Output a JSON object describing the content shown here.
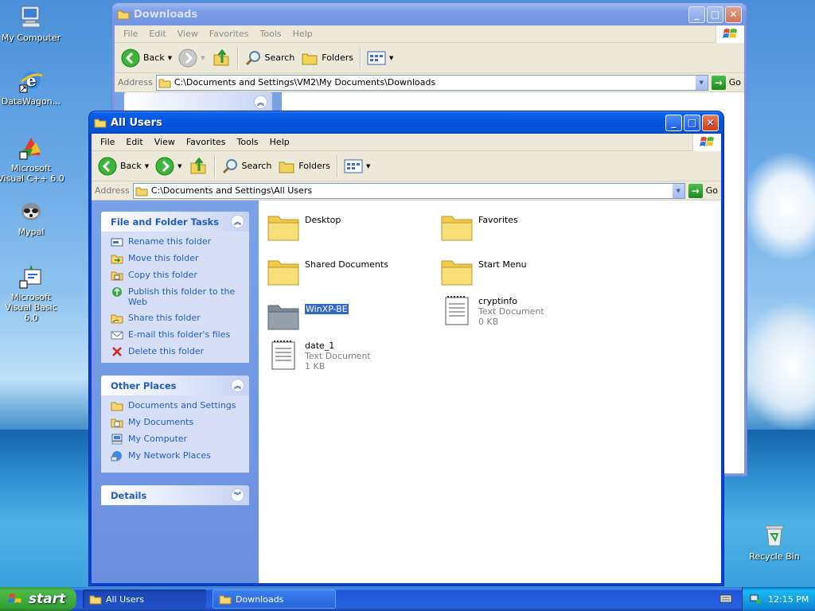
{
  "desktop": {
    "icons": [
      {
        "label": "My Computer",
        "icon": "my-computer-icon"
      },
      {
        "label": "DataWagon...",
        "icon": "internet-explorer-shortcut-icon"
      },
      {
        "label": "Microsoft Visual C++ 6.0",
        "icon": "visual-cpp-icon"
      },
      {
        "label": "Mypal",
        "icon": "mypal-icon"
      },
      {
        "label": "Microsoft Visual Basic 6.0",
        "icon": "visual-basic-icon"
      },
      {
        "label": "Recycle Bin",
        "icon": "recycle-bin-icon"
      }
    ]
  },
  "downloads_window": {
    "title": "Downloads",
    "menu": [
      "File",
      "Edit",
      "View",
      "Favorites",
      "Tools",
      "Help"
    ],
    "toolbar": {
      "back": "Back",
      "search": "Search",
      "folders": "Folders"
    },
    "address_label": "Address",
    "address": "C:\\Documents and Settings\\VM2\\My Documents\\Downloads",
    "go": "Go"
  },
  "allusers_window": {
    "title": "All Users",
    "menu": [
      "File",
      "Edit",
      "View",
      "Favorites",
      "Tools",
      "Help"
    ],
    "toolbar": {
      "back": "Back",
      "search": "Search",
      "folders": "Folders"
    },
    "address_label": "Address",
    "address": "C:\\Documents and Settings\\All Users",
    "go": "Go",
    "file_tasks": {
      "title": "File and Folder Tasks",
      "items": [
        "Rename this folder",
        "Move this folder",
        "Copy this folder",
        "Publish this folder to the Web",
        "Share this folder",
        "E-mail this folder's files",
        "Delete this folder"
      ]
    },
    "other_places": {
      "title": "Other Places",
      "items": [
        "Documents and Settings",
        "My Documents",
        "My Computer",
        "My Network Places"
      ]
    },
    "details": {
      "title": "Details"
    },
    "files": [
      {
        "name": "Desktop",
        "type": "",
        "size": ""
      },
      {
        "name": "Favorites",
        "type": "",
        "size": ""
      },
      {
        "name": "Shared Documents",
        "type": "",
        "size": ""
      },
      {
        "name": "Start Menu",
        "type": "",
        "size": ""
      },
      {
        "name": "WinXP-BE",
        "type": "",
        "size": ""
      },
      {
        "name": "cryptinfo",
        "type": "Text Document",
        "size": "0 KB"
      },
      {
        "name": "date_1",
        "type": "Text Document",
        "size": "1 KB"
      }
    ]
  },
  "taskbar": {
    "start": "start",
    "buttons": [
      "All Users",
      "Downloads"
    ],
    "clock": "12:15 PM"
  }
}
